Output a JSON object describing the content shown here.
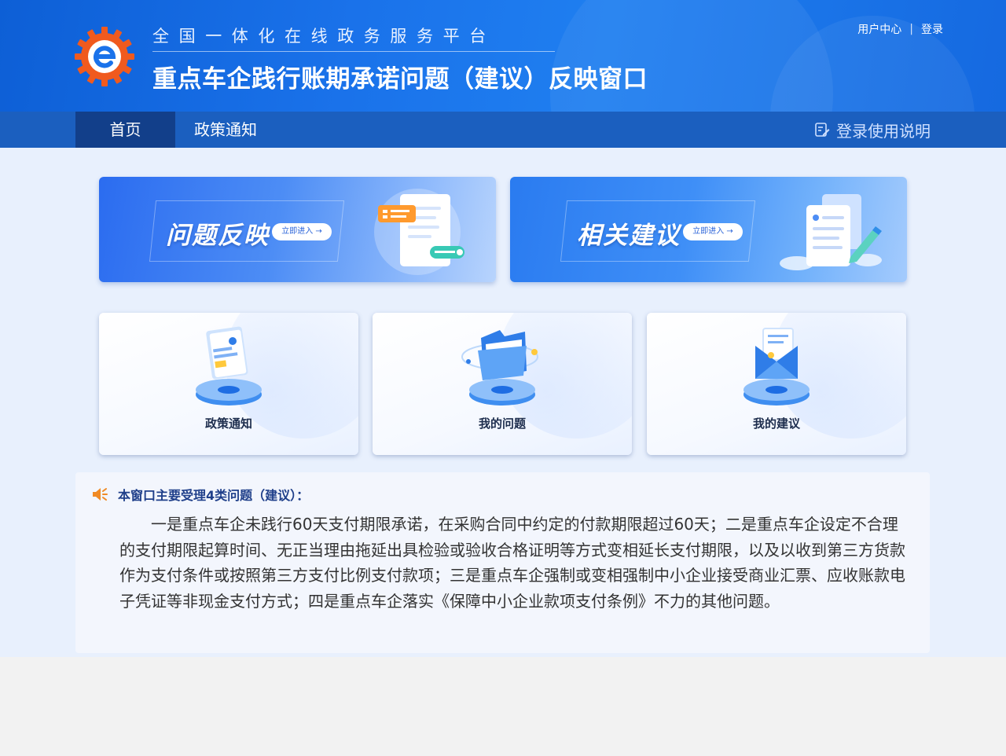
{
  "header": {
    "platform_name": "全国一体化在线政务服务平台",
    "title": "重点车企践行账期承诺问题（建议）反映窗口",
    "user_center": "用户中心",
    "separator": "|",
    "login": "登录"
  },
  "nav": {
    "items": [
      {
        "label": "首页"
      },
      {
        "label": "政策通知"
      }
    ],
    "help_label": "登录使用说明"
  },
  "banners": [
    {
      "title": "问题反映",
      "button": "立即进入 →"
    },
    {
      "title": "相关建议",
      "button": "立即进入 →"
    }
  ],
  "cards": [
    {
      "label": "政策通知"
    },
    {
      "label": "我的问题"
    },
    {
      "label": "我的建议"
    }
  ],
  "notice": {
    "title": "本窗口主要受理4类问题（建议）：",
    "body": "一是重点车企未践行60天支付期限承诺，在采购合同中约定的付款期限超过60天；二是重点车企设定不合理的支付期限起算时间、无正当理由拖延出具检验或验收合格证明等方式变相延长支付期限，以及以收到第三方货款作为支付条件或按照第三方支付比例支付款项；三是重点车企强制或变相强制中小企业接受商业汇票、应收账款电子凭证等非现金支付方式；四是重点车企落实《保障中小企业款项支付条例》不力的其他问题。"
  },
  "colors": {
    "header_blue": "#1a72ea",
    "nav_blue": "#1b5fbf",
    "nav_active": "#123f8a",
    "page_bg": "#e8f0fd",
    "logo_orange": "#f05a1e"
  }
}
